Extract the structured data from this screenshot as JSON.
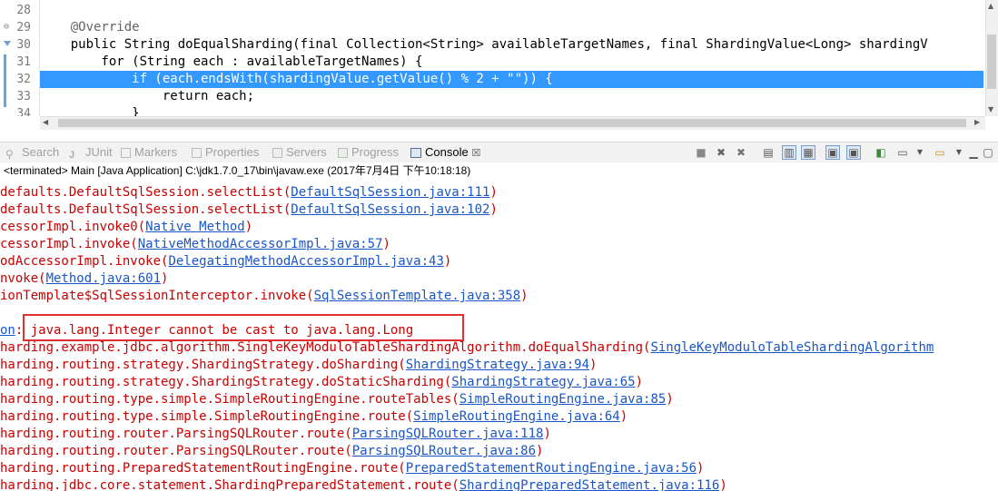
{
  "editor": {
    "lines": [
      {
        "no": "28",
        "text": ""
      },
      {
        "no": "29",
        "text": "    @Override"
      },
      {
        "no": "30",
        "text": "    public String doEqualSharding(final Collection<String> availableTargetNames, final ShardingValue<Long> shardingV"
      },
      {
        "no": "31",
        "text": "        for (String each : availableTargetNames) {"
      },
      {
        "no": "32",
        "text": "            if (each.endsWith(shardingValue.getValue() % 2 + \"\")) {"
      },
      {
        "no": "33",
        "text": "                return each;"
      },
      {
        "no": "34",
        "text": "            }"
      }
    ]
  },
  "tabs": [
    {
      "label": "Search",
      "icon": "search-icon"
    },
    {
      "label": "JUnit",
      "icon": "junit-icon"
    },
    {
      "label": "Markers",
      "icon": "markers-icon"
    },
    {
      "label": "Properties",
      "icon": "properties-icon"
    },
    {
      "label": "Servers",
      "icon": "servers-icon"
    },
    {
      "label": "Progress",
      "icon": "progress-icon"
    },
    {
      "label": "Console",
      "icon": "console-icon",
      "close": "☒"
    }
  ],
  "status": "<terminated> Main [Java Application] C:\\jdk1.7.0_17\\bin\\javaw.exe (2017年7月4日 下午10:18:18)",
  "console_lines": [
    {
      "pre": "defaults.DefaultSqlSession.selectList(",
      "link": "DefaultSqlSession.java:111",
      "post": ")"
    },
    {
      "pre": "defaults.DefaultSqlSession.selectList(",
      "link": "DefaultSqlSession.java:102",
      "post": ")"
    },
    {
      "pre": "cessorImpl.invoke0(",
      "link": "Native Method",
      "post": ")"
    },
    {
      "pre": "cessorImpl.invoke(",
      "link": "NativeMethodAccessorImpl.java:57",
      "post": ")"
    },
    {
      "pre": "odAccessorImpl.invoke(",
      "link": "DelegatingMethodAccessorImpl.java:43",
      "post": ")"
    },
    {
      "pre": "nvoke(",
      "link": "Method.java:601",
      "post": ")"
    },
    {
      "pre": "ionTemplate$SqlSessionInterceptor.invoke(",
      "link": "SqlSessionTemplate.java:358",
      "post": ")"
    },
    {
      "pre": "",
      "link": "",
      "post": ""
    },
    {
      "pre": "",
      "link": "on",
      "post": ": java.lang.Integer cannot be cast to java.lang.Long"
    },
    {
      "pre": "harding.example.jdbc.algorithm.SingleKeyModuloTableShardingAlgorithm.doEqualSharding(",
      "link": "SingleKeyModuloTableShardingAlgorithm",
      "post": ""
    },
    {
      "pre": "harding.routing.strategy.ShardingStrategy.doSharding(",
      "link": "ShardingStrategy.java:94",
      "post": ")"
    },
    {
      "pre": "harding.routing.strategy.ShardingStrategy.doStaticSharding(",
      "link": "ShardingStrategy.java:65",
      "post": ")"
    },
    {
      "pre": "harding.routing.type.simple.SimpleRoutingEngine.routeTables(",
      "link": "SimpleRoutingEngine.java:85",
      "post": ")"
    },
    {
      "pre": "harding.routing.type.simple.SimpleRoutingEngine.route(",
      "link": "SimpleRoutingEngine.java:64",
      "post": ")"
    },
    {
      "pre": "harding.routing.router.ParsingSQLRouter.route(",
      "link": "ParsingSQLRouter.java:118",
      "post": ")"
    },
    {
      "pre": "harding.routing.router.ParsingSQLRouter.route(",
      "link": "ParsingSQLRouter.java:86",
      "post": ")"
    },
    {
      "pre": "harding.routing.PreparedStatementRoutingEngine.route(",
      "link": "PreparedStatementRoutingEngine.java:56",
      "post": ")"
    },
    {
      "pre": "harding.jdbc.core.statement.ShardingPreparedStatement.route(",
      "link": "ShardingPreparedStatement.java:116",
      "post": ")"
    }
  ],
  "colors": {
    "error_text": "#c80000",
    "link": "#1a56c8",
    "highlight": "#3399ff",
    "annotation_box": "#e03030"
  }
}
